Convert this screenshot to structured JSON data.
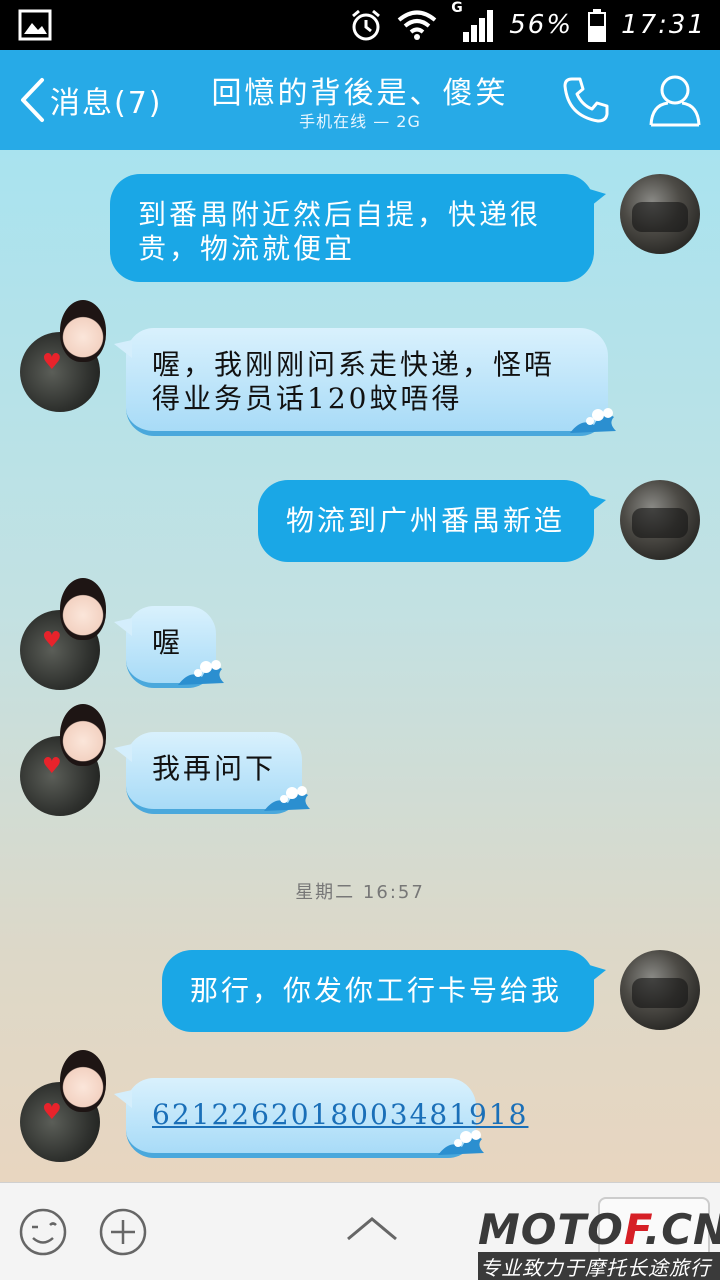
{
  "status_bar": {
    "network_type": "G",
    "battery": "56%",
    "time": "17:31",
    "icons": [
      "image-icon",
      "alarm-icon",
      "wifi-icon",
      "signal-icon",
      "battery-icon"
    ]
  },
  "header": {
    "back_label": "消息(7)",
    "title": "回憶的背後是、傻笑",
    "subtitle": "手机在线 — 2G",
    "colors": {
      "header_bg": "#27aae7"
    }
  },
  "messages": [
    {
      "from": "me",
      "text_line1": "到番禺附近然后自提，快递很",
      "text_line2": "贵，物流就便宜"
    },
    {
      "from": "her",
      "text_line1": "喔，我刚刚问系走快递，怪唔",
      "text_line2": "得业务员话120蚊唔得"
    },
    {
      "from": "me",
      "text": "物流到广州番禺新造"
    },
    {
      "from": "her",
      "text": "喔"
    },
    {
      "from": "her",
      "text": "我再问下"
    },
    {
      "from": "me",
      "text": "那行，你发你工行卡号给我"
    },
    {
      "from": "her",
      "text": "6212262018003481918",
      "is_link": true
    }
  ],
  "timestamp": "星期二 16:57",
  "bottom_bar": {
    "icons": [
      "emoji-icon",
      "plus-icon",
      "chevron-up-icon"
    ]
  },
  "watermark": {
    "brand_part1": "MOTO",
    "brand_part2": "F",
    "brand_part3": ".CN",
    "tagline": "专业致力于摩托长途旅行"
  }
}
